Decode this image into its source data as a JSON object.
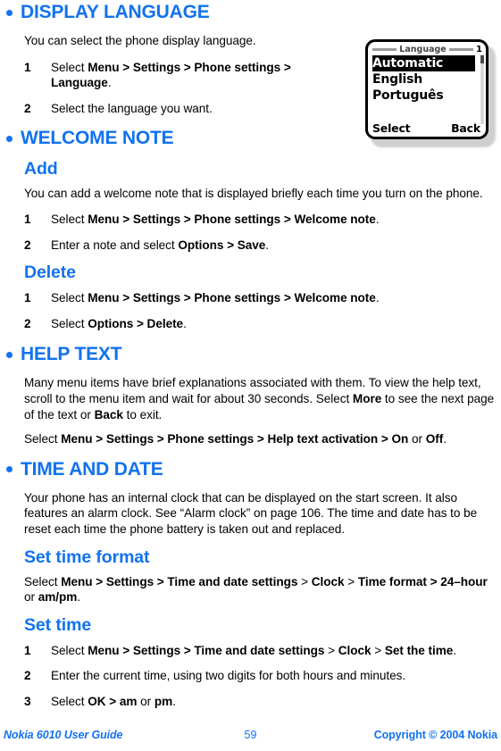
{
  "document": {
    "title": "Nokia 6010 User Guide",
    "page_number": "59",
    "copyright": "Copyright © 2004 Nokia",
    "accent_color": "#1272ef",
    "text_color": "#000000"
  },
  "sections": [
    {
      "heading": "DISPLAY LANGUAGE",
      "intro": "You can select the phone display language.",
      "steps": [
        {
          "num": "1",
          "html": "Select <b>Menu &gt; Settings &gt; Phone settings &gt; Language</b>."
        },
        {
          "num": "2",
          "html": "Select the language you want."
        }
      ]
    },
    {
      "heading": "WELCOME NOTE",
      "subsections": [
        {
          "heading": "Add",
          "intro": "You can add a welcome note that is displayed briefly each time you turn on the phone.",
          "steps": [
            {
              "num": "1",
              "html": "Select <b>Menu &gt; Settings &gt; Phone settings &gt; Welcome note</b>."
            },
            {
              "num": "2",
              "html": "Enter a note and select <b>Options &gt; Save</b>."
            }
          ]
        },
        {
          "heading": "Delete",
          "steps": [
            {
              "num": "1",
              "html": "Select <b>Menu &gt; Settings &gt; Phone settings &gt; Welcome note</b>."
            },
            {
              "num": "2",
              "html": "Select <b>Options &gt; Delete</b>."
            }
          ]
        }
      ]
    },
    {
      "heading": "HELP TEXT",
      "paragraphs": [
        "Many menu items have brief explanations associated with them. To view the help text, scroll to the menu item and wait for about 30 seconds. Select <b>More</b> to see the next page of the text or <b>Back</b> to exit.",
        "Select <b>Menu &gt; Settings &gt; Phone settings &gt; Help text activation &gt; On</b> or <b>Off</b>."
      ]
    },
    {
      "heading": "TIME AND DATE",
      "intro": "Your phone has an internal clock that can be displayed on the start screen. It also features an alarm clock. See “Alarm clock” on page 106. The time and date has to be reset each time the phone battery is taken out and replaced.",
      "subsections": [
        {
          "heading": "Set time format",
          "paragraph": "Select <b>Menu &gt; Settings &gt; Time and date settings</b> &gt; <b>Clock</b> &gt; <b>Time format &gt; 24–hour</b> or <b>am/pm</b>."
        },
        {
          "heading": "Set time",
          "steps": [
            {
              "num": "1",
              "html": "Select <b>Menu &gt; Settings &gt; Time and date settings</b> &gt; <b>Clock</b> &gt; <b>Set the time</b>."
            },
            {
              "num": "2",
              "html": "Enter the current time, using two digits for both hours and minutes."
            },
            {
              "num": "3",
              "html": "Select <b>OK &gt; am</b> or <b>pm</b>."
            }
          ]
        }
      ]
    }
  ],
  "phone_screen": {
    "title": "Language",
    "page_indicator": "1",
    "items": [
      {
        "label": "Automatic",
        "selected": true
      },
      {
        "label": "English",
        "selected": false
      },
      {
        "label": "Português",
        "selected": false
      }
    ],
    "softkey_left": "Select",
    "softkey_right": "Back"
  }
}
